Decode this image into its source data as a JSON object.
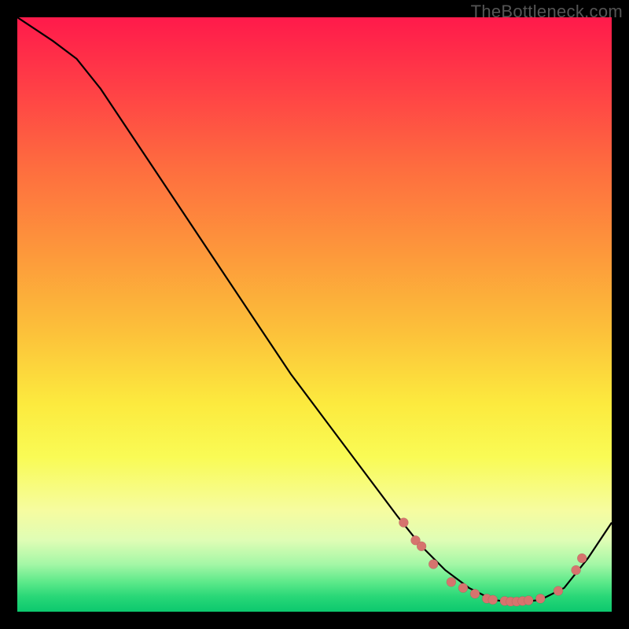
{
  "watermark": "TheBottleneck.com",
  "colors": {
    "background": "#000000",
    "gradient_top": "#ff1a4b",
    "gradient_bottom": "#0cc86e",
    "curve_stroke": "#000000",
    "dot_fill": "#d6746e"
  },
  "chart_data": {
    "type": "line",
    "title": "",
    "xlabel": "",
    "ylabel": "",
    "axes_visible": false,
    "grid": false,
    "xlim": [
      0,
      100
    ],
    "ylim": [
      0,
      100
    ],
    "note": "Axes have no tick labels in the source image; x and y are normalized 0–100. Curve approximated from pixel positions.",
    "series": [
      {
        "name": "curve",
        "x": [
          0,
          3,
          6,
          10,
          14,
          18,
          22,
          28,
          34,
          40,
          46,
          52,
          58,
          64,
          68,
          72,
          76,
          80,
          84,
          88,
          92,
          96,
          100
        ],
        "y": [
          100,
          98,
          96,
          93,
          88,
          82,
          76,
          67,
          58,
          49,
          40,
          32,
          24,
          16,
          11,
          7,
          4,
          2,
          1.5,
          2,
          4,
          9,
          15
        ],
        "style": "line"
      },
      {
        "name": "points",
        "x": [
          65,
          67,
          68,
          70,
          73,
          75,
          77,
          79,
          80,
          82,
          83,
          84,
          85,
          86,
          88,
          91,
          94,
          95
        ],
        "y": [
          15,
          12,
          11,
          8,
          5,
          4,
          3,
          2.2,
          2,
          1.8,
          1.7,
          1.7,
          1.8,
          1.9,
          2.2,
          3.5,
          7,
          9
        ],
        "style": "scatter"
      }
    ]
  }
}
